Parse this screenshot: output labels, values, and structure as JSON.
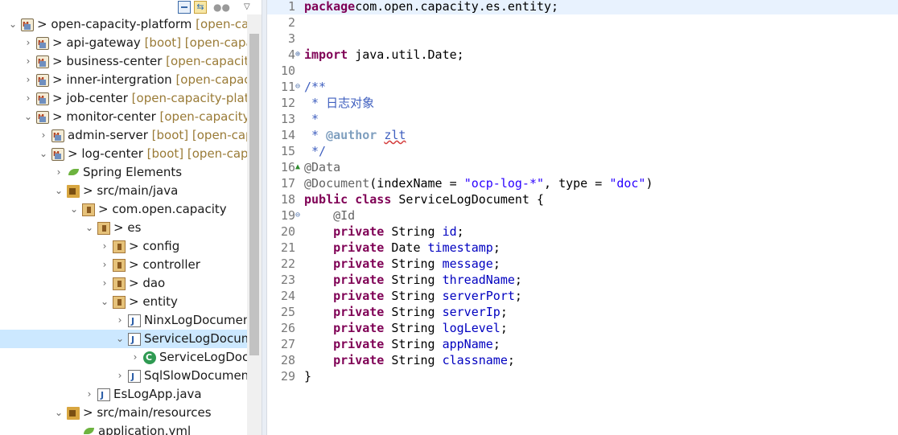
{
  "explorer": {
    "toolbar": {
      "collapse_icon": "collapse-all-icon",
      "link_icon": "link-with-editor-icon",
      "focus_icon": "focus-icon",
      "menu_icon": "view-menu-icon"
    },
    "tree": [
      {
        "indent": 0,
        "twisty": "v",
        "icon": "maven-project-icon",
        "prefix": "> ",
        "label": "open-capacity-platform",
        "decor": "[open-ca",
        "selected": false
      },
      {
        "indent": 1,
        "twisty": ">",
        "icon": "maven-project-icon",
        "prefix": "> ",
        "label": "api-gateway",
        "decor": "[boot] [open-capa",
        "selected": false
      },
      {
        "indent": 1,
        "twisty": ">",
        "icon": "maven-project-icon",
        "prefix": "> ",
        "label": "business-center",
        "decor": "[open-capacity",
        "selected": false
      },
      {
        "indent": 1,
        "twisty": ">",
        "icon": "maven-project-icon",
        "prefix": "> ",
        "label": "inner-intergration",
        "decor": "[open-capac",
        "selected": false
      },
      {
        "indent": 1,
        "twisty": ">",
        "icon": "maven-project-icon",
        "prefix": "> ",
        "label": "job-center",
        "decor": "[open-capacity-plat",
        "selected": false
      },
      {
        "indent": 1,
        "twisty": "v",
        "icon": "maven-project-icon",
        "prefix": "> ",
        "label": "monitor-center",
        "decor": "[open-capacity",
        "selected": false
      },
      {
        "indent": 2,
        "twisty": ">",
        "icon": "maven-project-icon",
        "prefix": "",
        "label": "admin-server",
        "decor": "[boot] [open-cap",
        "selected": false
      },
      {
        "indent": 2,
        "twisty": "v",
        "icon": "maven-project-icon",
        "prefix": "> ",
        "label": "log-center",
        "decor": "[boot] [open-cap",
        "selected": false
      },
      {
        "indent": 3,
        "twisty": ">",
        "icon": "spring-icon",
        "prefix": "",
        "label": "Spring Elements",
        "decor": "",
        "selected": false
      },
      {
        "indent": 3,
        "twisty": "v",
        "icon": "source-folder-icon",
        "prefix": "> ",
        "label": "src/main/java",
        "decor": "",
        "selected": false
      },
      {
        "indent": 4,
        "twisty": "v",
        "icon": "package-icon",
        "prefix": "> ",
        "label": "com.open.capacity",
        "decor": "",
        "selected": false
      },
      {
        "indent": 5,
        "twisty": "v",
        "icon": "package-icon",
        "prefix": "> ",
        "label": "es",
        "decor": "",
        "selected": false
      },
      {
        "indent": 6,
        "twisty": ">",
        "icon": "package-icon",
        "prefix": "> ",
        "label": "config",
        "decor": "",
        "selected": false
      },
      {
        "indent": 6,
        "twisty": ">",
        "icon": "package-icon",
        "prefix": "> ",
        "label": "controller",
        "decor": "",
        "selected": false
      },
      {
        "indent": 6,
        "twisty": ">",
        "icon": "package-icon",
        "prefix": "> ",
        "label": "dao",
        "decor": "",
        "selected": false
      },
      {
        "indent": 6,
        "twisty": "v",
        "icon": "package-icon",
        "prefix": "> ",
        "label": "entity",
        "decor": "",
        "selected": false
      },
      {
        "indent": 7,
        "twisty": ">",
        "icon": "java-file-icon",
        "prefix": "",
        "label": "NinxLogDocumen",
        "decor": "",
        "selected": false
      },
      {
        "indent": 7,
        "twisty": "v",
        "icon": "java-file-icon",
        "prefix": "",
        "label": "ServiceLogDocum",
        "decor": "",
        "selected": true
      },
      {
        "indent": 8,
        "twisty": ">",
        "icon": "class-icon",
        "prefix": "",
        "label": "ServiceLogDoc",
        "decor": "",
        "selected": false
      },
      {
        "indent": 7,
        "twisty": ">",
        "icon": "java-file-icon",
        "prefix": "",
        "label": "SqlSlowDocumen",
        "decor": "",
        "selected": false
      },
      {
        "indent": 5,
        "twisty": ">",
        "icon": "java-file-icon",
        "prefix": "",
        "label": "EsLogApp.java",
        "decor": "",
        "selected": false
      },
      {
        "indent": 3,
        "twisty": "v",
        "icon": "source-folder-icon",
        "prefix": "> ",
        "label": "src/main/resources",
        "decor": "",
        "selected": false
      },
      {
        "indent": 4,
        "twisty": "",
        "icon": "yml-file-icon",
        "prefix": "",
        "label": "application.yml",
        "decor": "",
        "selected": false
      }
    ]
  },
  "editor": {
    "file": "ServiceLogDocument.java",
    "lines": [
      {
        "n": "1",
        "fold": "",
        "current": true,
        "tokens": [
          [
            "kw",
            "package"
          ],
          [
            "",
            "com.open.capacity.es.entity;"
          ]
        ]
      },
      {
        "n": "2",
        "fold": "",
        "current": false,
        "tokens": []
      },
      {
        "n": "3",
        "fold": "",
        "current": false,
        "tokens": []
      },
      {
        "n": "4",
        "fold": "⊕",
        "current": false,
        "tokens": [
          [
            "kw",
            "import"
          ],
          [
            "",
            " java.util.Date;"
          ]
        ]
      },
      {
        "n": "10",
        "fold": "",
        "current": false,
        "tokens": []
      },
      {
        "n": "11",
        "fold": "⊖",
        "current": false,
        "tokens": [
          [
            "cmt",
            "/**"
          ]
        ]
      },
      {
        "n": "12",
        "fold": "",
        "current": false,
        "tokens": [
          [
            "cmt",
            " * 日志对象"
          ]
        ]
      },
      {
        "n": "13",
        "fold": "",
        "current": false,
        "tokens": [
          [
            "cmt",
            " *"
          ]
        ]
      },
      {
        "n": "14",
        "fold": "",
        "current": false,
        "tokens": [
          [
            "cmt",
            " * "
          ],
          [
            "tag",
            "@author"
          ],
          [
            "cmt",
            " "
          ],
          [
            "cmt squig",
            "zlt"
          ]
        ]
      },
      {
        "n": "15",
        "fold": "",
        "current": false,
        "tokens": [
          [
            "cmt",
            " */"
          ]
        ]
      },
      {
        "n": "16",
        "fold": "▲",
        "current": false,
        "tokens": [
          [
            "anno",
            "@Data"
          ]
        ]
      },
      {
        "n": "17",
        "fold": "",
        "current": false,
        "tokens": [
          [
            "anno",
            "@Document"
          ],
          [
            "",
            "(indexName = "
          ],
          [
            "str",
            "\"ocp-log-*\""
          ],
          [
            "",
            ", type = "
          ],
          [
            "str",
            "\"doc\""
          ],
          [
            "",
            ")"
          ]
        ]
      },
      {
        "n": "18",
        "fold": "",
        "current": false,
        "tokens": [
          [
            "kw",
            "public"
          ],
          [
            "",
            " "
          ],
          [
            "kw",
            "class"
          ],
          [
            "",
            " ServiceLogDocument {"
          ]
        ]
      },
      {
        "n": "19",
        "fold": "⊖",
        "current": false,
        "tokens": [
          [
            "",
            "    "
          ],
          [
            "anno",
            "@Id"
          ]
        ]
      },
      {
        "n": "20",
        "fold": "",
        "current": false,
        "tokens": [
          [
            "",
            "    "
          ],
          [
            "kw",
            "private"
          ],
          [
            "",
            " String "
          ],
          [
            "field",
            "id"
          ],
          [
            "",
            ";"
          ]
        ]
      },
      {
        "n": "21",
        "fold": "",
        "current": false,
        "tokens": [
          [
            "",
            "    "
          ],
          [
            "kw",
            "private"
          ],
          [
            "",
            " Date "
          ],
          [
            "field",
            "timestamp"
          ],
          [
            "",
            ";"
          ]
        ]
      },
      {
        "n": "22",
        "fold": "",
        "current": false,
        "tokens": [
          [
            "",
            "    "
          ],
          [
            "kw",
            "private"
          ],
          [
            "",
            " String "
          ],
          [
            "field",
            "message"
          ],
          [
            "",
            ";"
          ]
        ]
      },
      {
        "n": "23",
        "fold": "",
        "current": false,
        "tokens": [
          [
            "",
            "    "
          ],
          [
            "kw",
            "private"
          ],
          [
            "",
            " String "
          ],
          [
            "field",
            "threadName"
          ],
          [
            "",
            ";"
          ]
        ]
      },
      {
        "n": "24",
        "fold": "",
        "current": false,
        "tokens": [
          [
            "",
            "    "
          ],
          [
            "kw",
            "private"
          ],
          [
            "",
            " String "
          ],
          [
            "field",
            "serverPort"
          ],
          [
            "",
            ";"
          ]
        ]
      },
      {
        "n": "25",
        "fold": "",
        "current": false,
        "tokens": [
          [
            "",
            "    "
          ],
          [
            "kw",
            "private"
          ],
          [
            "",
            " String "
          ],
          [
            "field",
            "serverIp"
          ],
          [
            "",
            ";"
          ]
        ]
      },
      {
        "n": "26",
        "fold": "",
        "current": false,
        "tokens": [
          [
            "",
            "    "
          ],
          [
            "kw",
            "private"
          ],
          [
            "",
            " String "
          ],
          [
            "field",
            "logLevel"
          ],
          [
            "",
            ";"
          ]
        ]
      },
      {
        "n": "27",
        "fold": "",
        "current": false,
        "tokens": [
          [
            "",
            "    "
          ],
          [
            "kw",
            "private"
          ],
          [
            "",
            " String "
          ],
          [
            "field",
            "appName"
          ],
          [
            "",
            ";"
          ]
        ]
      },
      {
        "n": "28",
        "fold": "",
        "current": false,
        "tokens": [
          [
            "",
            "    "
          ],
          [
            "kw",
            "private"
          ],
          [
            "",
            " String "
          ],
          [
            "field",
            "classname"
          ],
          [
            "",
            ";"
          ]
        ]
      },
      {
        "n": "29",
        "fold": "",
        "current": false,
        "tokens": [
          [
            "",
            "}"
          ]
        ]
      }
    ]
  }
}
